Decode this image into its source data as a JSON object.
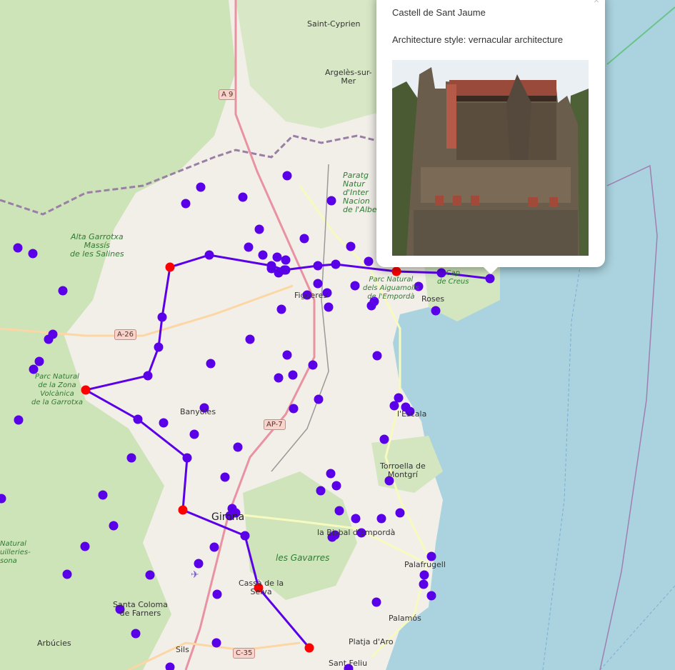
{
  "map": {
    "labels": {
      "saint_cyprien": "Saint-Cyprien",
      "argeles": "Argelès-sur-\nMer",
      "alta_garrotxa": "Alta Garrotxa\nMassís\nde les Salines",
      "parc_natural_zona": "Parc Natural\nde la Zona\nVolcànica\nde la Garrotxa",
      "paratge": "Paratg\nNatur\nd'Inter\nNacion\nde l'Albe",
      "aiguamolls": "Parc Natural\ndels Aiguamolls\nde l'Empordà",
      "cap_creus": "Cap\nde Creus",
      "figueres": "Figueres",
      "roses": "Roses",
      "banyoles": "Banyoles",
      "lescala": "l'Escala",
      "torroella": "Torroella de\nMontgrí",
      "girona": "Girona",
      "bisbal": "la Bisbal d'Empordà",
      "gavarres": "les Gavarres",
      "palafrugell": "Palafrugell",
      "cassa": "Cassà de la\nSelva",
      "santa_coloma": "Santa Coloma\nde Farners",
      "palamos": "Palamós",
      "arbucies": "Arbúcies",
      "sils": "Sils",
      "platja_aro": "Platja d'Aro",
      "sant_feliu": "Sant Feliu",
      "natural_guilleries": "Natural\nuilleries-\nsona"
    },
    "roads": {
      "a9": "A 9",
      "a26": "A-26",
      "ap7": "AP-7",
      "c35": "C-35"
    },
    "route_color": "#5a00e8",
    "marker_color": "#5a00e8",
    "stop_color": "#ff0000",
    "land_color": "#f2efe9",
    "forest_color": "#c8e2b0",
    "sea_color": "#aad3df"
  },
  "popup": {
    "title": "Castell de Sant Jaume",
    "architecture": "Architecture style: vernacular architecture",
    "close_glyph": "×"
  }
}
